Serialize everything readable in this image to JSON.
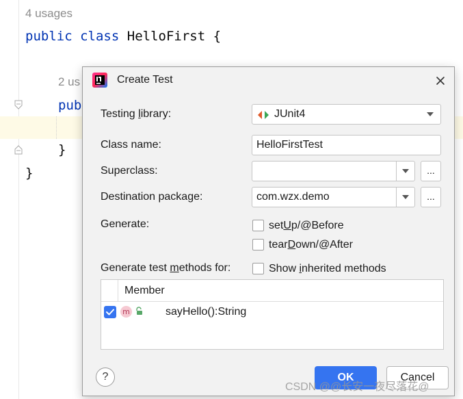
{
  "editor": {
    "usages_hint_top": "4 usages",
    "class_decl_keyword1": "public",
    "class_decl_keyword2": "class",
    "class_decl_name": "HelloFirst {",
    "usages_hint_inner": "2 us",
    "method_keyword_partial": "pub",
    "inner_close_brace": "}",
    "outer_close_brace": "}"
  },
  "dialog": {
    "title": "Create Test",
    "testing_library_label_pre": "Testing ",
    "testing_library_label_u": "l",
    "testing_library_label_post": "ibrary:",
    "testing_library_value": "JUnit4",
    "class_name_label": "Class name:",
    "class_name_value": "HelloFirstTest",
    "superclass_label": "Superclass:",
    "superclass_value": "",
    "destination_package_label": "Destination package:",
    "destination_package_value": "com.wzx.demo",
    "browse_button": "...",
    "generate_label": "Generate:",
    "setup_pre": "set",
    "setup_u": "U",
    "setup_post": "p/@Before",
    "teardown_pre": "tear",
    "teardown_u": "D",
    "teardown_post": "own/@After",
    "methods_label_pre": "Generate test ",
    "methods_label_u": "m",
    "methods_label_post": "ethods for:",
    "show_inherited_pre": "Show ",
    "show_inherited_u": "i",
    "show_inherited_post": "nherited methods",
    "table": {
      "column_header": "Member",
      "rows": [
        {
          "badge": "m",
          "label": "sayHello():String",
          "checked": true
        }
      ]
    },
    "help_button": "?",
    "ok_button": "OK",
    "cancel_button": "Cancel"
  },
  "watermark": "CSDN @@长安一夜尽落花@",
  "colors": {
    "accent": "#3574f0",
    "keyword": "#0033b3",
    "caret_line": "#fefae6",
    "dialog_bg": "#f2f2f2"
  },
  "icons": [
    "intellij-app-icon",
    "close-icon",
    "junit-icon",
    "chevron-down-icon",
    "checkmark-icon",
    "method-badge-icon",
    "unlock-icon",
    "fold-marker-icon"
  ]
}
